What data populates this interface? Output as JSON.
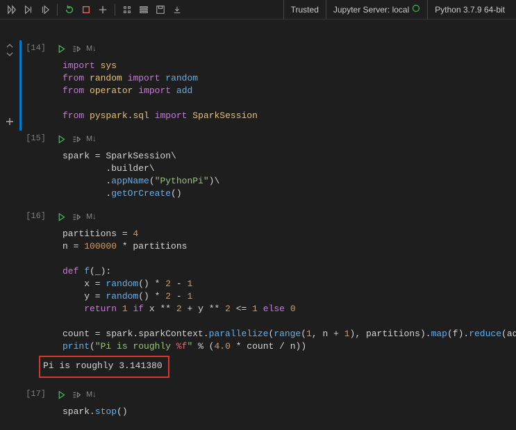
{
  "toolbar": {
    "right": {
      "trusted": "Trusted",
      "server": "Jupyter Server: local",
      "kernel": "Python 3.7.9 64-bit"
    }
  },
  "cells": [
    {
      "prompt": "[14]",
      "md": "M↓",
      "code_html": "<span class='kw'>import</span> <span class='mod'>sys</span>\n<span class='kw'>from</span> <span class='mod'>random</span> <span class='kw'>import</span> <span class='fn'>random</span>\n<span class='kw'>from</span> <span class='mod'>operator</span> <span class='kw'>import</span> <span class='fn'>add</span>\n\n<span class='kw'>from</span> <span class='mod'>pyspark.sql</span> <span class='kw'>import</span> <span class='mod'>SparkSession</span>"
    },
    {
      "prompt": "[15]",
      "md": "M↓",
      "code_html": "spark = SparkSession\\\n        .builder\\\n        .<span class='fn'>appName</span>(<span class='str'>\"PythonPi\"</span>)\\\n        .<span class='fn'>getOrCreate</span>()"
    },
    {
      "prompt": "[16]",
      "md": "M↓",
      "code_html": "partitions = <span class='num'>4</span>\nn = <span class='num'>100000</span> * partitions\n\n<span class='kw'>def</span> <span class='fn'>f</span>(_):\n    x = <span class='fn'>random</span>() * <span class='num'>2</span> - <span class='num'>1</span>\n    y = <span class='fn'>random</span>() * <span class='num'>2</span> - <span class='num'>1</span>\n    <span class='kw'>return</span> <span class='num'>1</span> <span class='kw'>if</span> x ** <span class='num'>2</span> + y ** <span class='num'>2</span> &lt;= <span class='num'>1</span> <span class='kw'>else</span> <span class='num'>0</span>\n\ncount = spark.sparkContext.<span class='fn'>parallelize</span>(<span class='fn'>range</span>(<span class='num'>1</span>, n + <span class='num'>1</span>), partitions).<span class='fn'>map</span>(f).<span class='fn'>reduce</span>(add)\n<span class='fn'>print</span>(<span class='str'>\"Pi is roughly </span><span class='id'>%f</span><span class='str'>\"</span> % (<span class='num'>4.0</span> * count / n))",
      "output": "Pi is roughly 3.141380"
    },
    {
      "prompt": "[17]",
      "md": "M↓",
      "code_html": "spark.<span class='fn'>stop</span>()"
    }
  ]
}
